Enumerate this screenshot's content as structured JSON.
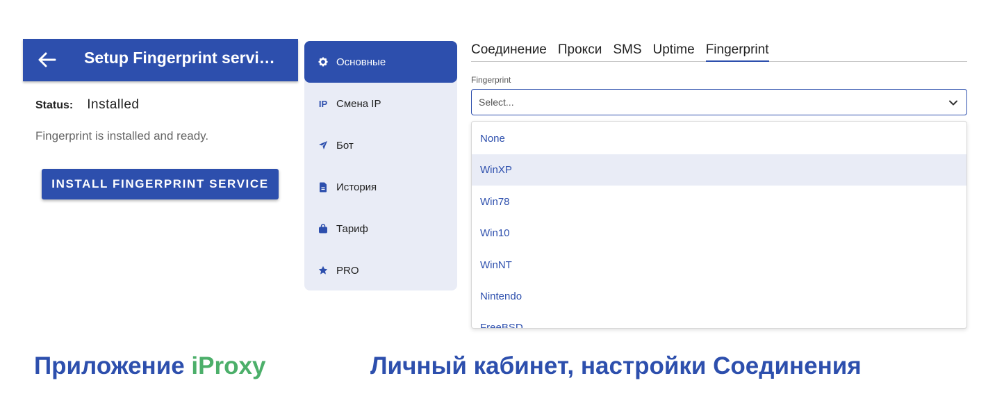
{
  "app": {
    "title": "Setup Fingerprint servi…",
    "status_label": "Status:",
    "status_value": "Installed",
    "description": "Fingerprint is installed and ready.",
    "install_button": "INSTALL FINGERPRINT SERVICE",
    "bar_color": "#2d4fad"
  },
  "sidebar": {
    "items": [
      {
        "icon": "gear-icon",
        "label": "Основные",
        "active": true
      },
      {
        "icon": "ip-icon",
        "icon_text": "IP",
        "label": "Смена IP",
        "active": false
      },
      {
        "icon": "paper-plane-icon",
        "label": "Бот",
        "active": false
      },
      {
        "icon": "document-icon",
        "label": "История",
        "active": false
      },
      {
        "icon": "shopping-bag-icon",
        "label": "Тариф",
        "active": false
      },
      {
        "icon": "star-icon",
        "label": "PRO",
        "active": false
      }
    ]
  },
  "settings": {
    "tabs": [
      {
        "label": "Соединение",
        "active": false
      },
      {
        "label": "Прокси",
        "active": false
      },
      {
        "label": "SMS",
        "active": false
      },
      {
        "label": "Uptime",
        "active": false
      },
      {
        "label": "Fingerprint",
        "active": true
      }
    ],
    "field_label": "Fingerprint",
    "select_placeholder": "Select...",
    "options": [
      {
        "label": "None",
        "highlighted": false
      },
      {
        "label": "WinXP",
        "highlighted": true
      },
      {
        "label": "Win78",
        "highlighted": false
      },
      {
        "label": "Win10",
        "highlighted": false
      },
      {
        "label": "WinNT",
        "highlighted": false
      },
      {
        "label": "Nintendo",
        "highlighted": false
      },
      {
        "label": "FreeBSD",
        "highlighted": false
      }
    ]
  },
  "captions": {
    "left_prefix": "Приложение ",
    "left_brand": "iProxy",
    "right": "Личный кабинет, настройки Соединения",
    "accent_color": "#2d4fad",
    "brand_color": "#4caf6a"
  }
}
